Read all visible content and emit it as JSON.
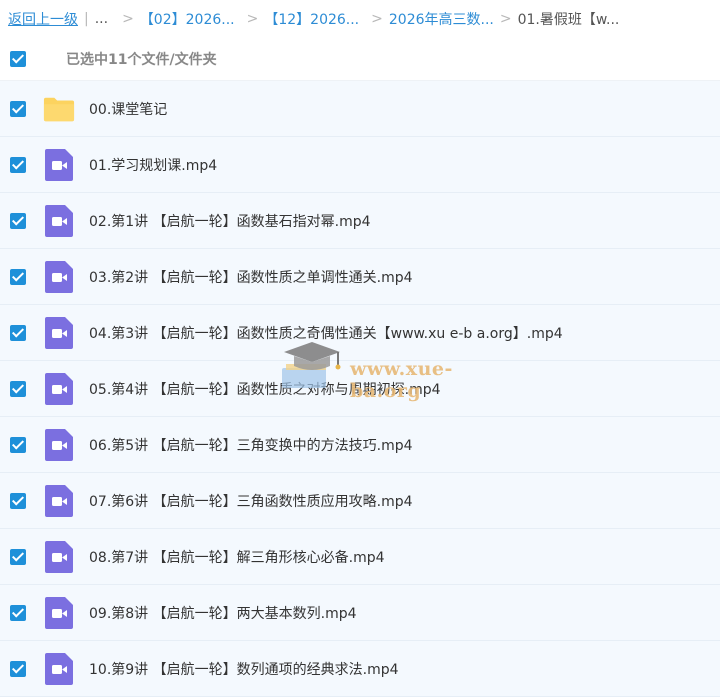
{
  "breadcrumb": {
    "back_label": "返回上一级",
    "separator_bar": "|",
    "ellipsis": "...",
    "chevron": ">",
    "items": [
      "【02】2026...",
      "【12】2026...",
      "2026年高三数..."
    ],
    "current": "01.暑假班【w..."
  },
  "selection": {
    "text": "已选中11个文件/文件夹"
  },
  "files": [
    {
      "name": "00.课堂笔记",
      "type": "folder"
    },
    {
      "name": "01.学习规划课.mp4",
      "type": "video"
    },
    {
      "name": "02.第1讲 【启航一轮】函数基石指对幂.mp4",
      "type": "video"
    },
    {
      "name": "03.第2讲 【启航一轮】函数性质之单调性通关.mp4",
      "type": "video"
    },
    {
      "name": "04.第3讲 【启航一轮】函数性质之奇偶性通关【www.xu e-b a.org】.mp4",
      "type": "video"
    },
    {
      "name": "05.第4讲 【启航一轮】函数性质之对称与周期初探.mp4",
      "type": "video"
    },
    {
      "name": "06.第5讲 【启航一轮】三角变换中的方法技巧.mp4",
      "type": "video"
    },
    {
      "name": "07.第6讲 【启航一轮】三角函数性质应用攻略.mp4",
      "type": "video"
    },
    {
      "name": "08.第7讲 【启航一轮】解三角形核心必备.mp4",
      "type": "video"
    },
    {
      "name": "09.第8讲 【启航一轮】两大基本数列.mp4",
      "type": "video"
    },
    {
      "name": "10.第9讲 【启航一轮】数列通项的经典求法.mp4",
      "type": "video"
    }
  ],
  "watermark": {
    "text": "www.xue-ba.org"
  },
  "colors": {
    "accent": "#1e90d9",
    "link": "#2d8cd5",
    "row_bg": "#f4f9fe",
    "folder": "#fcd35f",
    "video": "#7b6fe0"
  }
}
